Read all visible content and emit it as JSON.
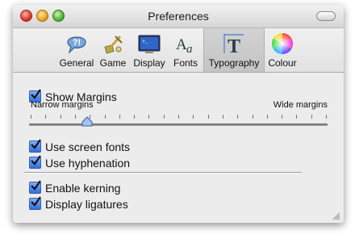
{
  "window": {
    "title": "Preferences"
  },
  "toolbar": {
    "items": [
      {
        "label": "General",
        "icon": "general-help-icon"
      },
      {
        "label": "Game",
        "icon": "game-icon"
      },
      {
        "label": "Display",
        "icon": "display-monitor-icon"
      },
      {
        "label": "Fonts",
        "icon": "fonts-icon"
      },
      {
        "label": "Typography",
        "icon": "typography-icon",
        "selected": true
      },
      {
        "label": "Colour",
        "icon": "colour-wheel-icon"
      }
    ]
  },
  "typography": {
    "show_margins": {
      "label": "Show Margins",
      "checked": true
    },
    "margin_slider": {
      "min_label": "Narrow margins",
      "max_label": "Wide margins",
      "value_fraction": 0.19
    },
    "use_screen_fonts": {
      "label": "Use screen fonts",
      "checked": true
    },
    "use_hyphenation": {
      "label": "Use hyphenation",
      "checked": true
    },
    "enable_kerning": {
      "label": "Enable kerning",
      "checked": true
    },
    "display_ligatures": {
      "label": "Display ligatures",
      "checked": true
    }
  },
  "colors": {
    "checkbox_blue": "#2d6fe0",
    "window_bg": "#ececec"
  }
}
